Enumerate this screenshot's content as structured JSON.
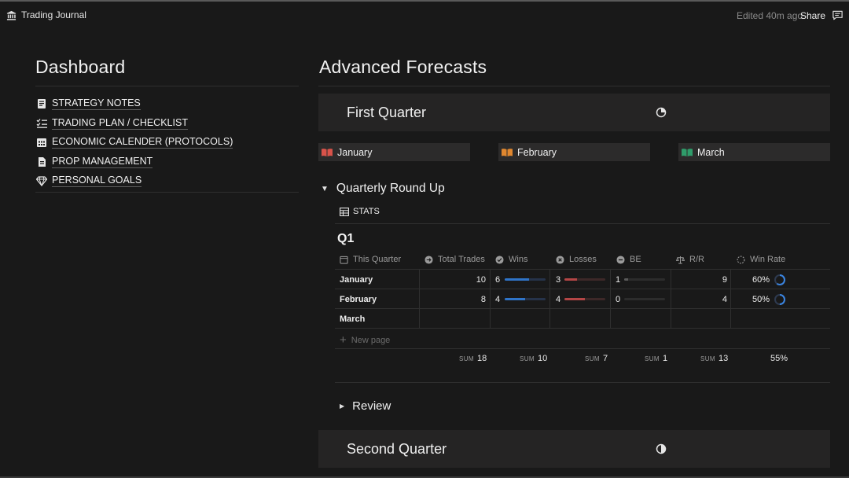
{
  "topbar": {
    "breadcrumb": "Trading Journal",
    "edited": "Edited 40m ago",
    "share": "Share"
  },
  "dashboard": {
    "title": "Dashboard",
    "items": [
      {
        "label": "STRATEGY NOTES",
        "icon": "notebook-icon"
      },
      {
        "label": "TRADING PLAN / CHECKLIST",
        "icon": "checklist-icon"
      },
      {
        "label": "ECONOMIC CALENDER (PROTOCOLS)",
        "icon": "calendar-icon"
      },
      {
        "label": "PROP MANAGEMENT",
        "icon": "document-icon"
      },
      {
        "label": "PERSONAL GOALS",
        "icon": "diamond-icon"
      }
    ]
  },
  "forecasts": {
    "title": "Advanced Forecasts",
    "first_quarter": "First Quarter",
    "months": [
      {
        "label": "January",
        "color": "#d9534a"
      },
      {
        "label": "February",
        "color": "#e0872f"
      },
      {
        "label": "March",
        "color": "#2f9c6a"
      }
    ],
    "roundup": "Quarterly Round Up",
    "stats_tab": "STATS",
    "table_title": "Q1",
    "columns": [
      "This Quarter",
      "Total Trades",
      "Wins",
      "Losses",
      "BE",
      "R/R",
      "Win Rate"
    ],
    "rows": [
      {
        "month": "January",
        "total": "10",
        "wins": "6",
        "losses": "3",
        "be": "1",
        "rr": "9",
        "winrate": "60%",
        "wins_frac": 0.6,
        "losses_frac": 0.3,
        "be_frac": 0.1,
        "winrate_frac": 0.6
      },
      {
        "month": "February",
        "total": "8",
        "wins": "4",
        "losses": "4",
        "be": "0",
        "rr": "4",
        "winrate": "50%",
        "wins_frac": 0.5,
        "losses_frac": 0.5,
        "be_frac": 0.0,
        "winrate_frac": 0.5
      },
      {
        "month": "March",
        "total": "",
        "wins": "",
        "losses": "",
        "be": "",
        "rr": "",
        "winrate": ""
      }
    ],
    "new_page": "New page",
    "sum_label": "SUM",
    "sums": {
      "total": "18",
      "wins": "10",
      "losses": "7",
      "be": "1",
      "rr": "13",
      "winrate": "55%"
    },
    "review": "Review",
    "second_quarter": "Second Quarter"
  },
  "colors": {
    "wins": "#2f74c8",
    "losses": "#b44646",
    "be": "#5a5a5a",
    "winrate": "#3a84e0"
  }
}
